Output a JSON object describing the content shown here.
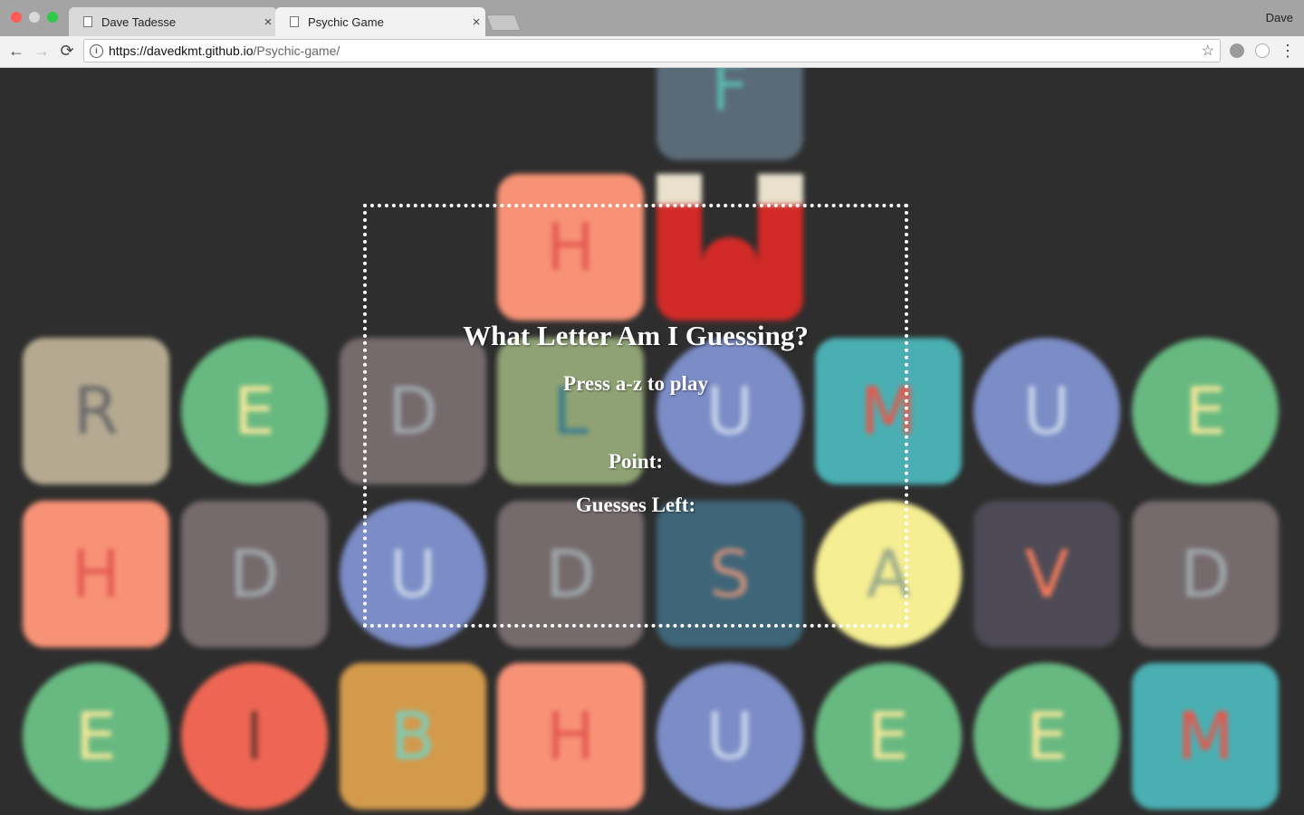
{
  "browser": {
    "tabs": [
      {
        "title": "Dave Tadesse",
        "active": false
      },
      {
        "title": "Psychic Game",
        "active": true
      }
    ],
    "profile_name": "Dave",
    "url_host": "https://davedkmt.github.io",
    "url_path": "/Psychic-game/",
    "close_glyph": "×",
    "back_glyph": "←",
    "forward_glyph": "→",
    "reload_glyph": "⟳",
    "star_glyph": "☆",
    "menu_glyph": "⋮"
  },
  "game": {
    "title": "What Letter Am I Guessing?",
    "instructions": "Press a-z to play",
    "point_label": "Point:",
    "guesses_left_label": "Guesses Left:"
  },
  "background_tiles": [
    {
      "letter": "F",
      "bg": "#5a6b78",
      "fg": "#5ab8b0",
      "shape": "sq"
    },
    {
      "letter": "H",
      "bg": "#f79276",
      "fg": "#e45a52",
      "shape": "sq"
    },
    {
      "letter": "L",
      "bg": "#d22a27",
      "fg": "#e9e1cc",
      "shape": "sq"
    },
    {
      "letter": "R",
      "bg": "#b5aa91",
      "fg": "#6b6b6b",
      "shape": "sq"
    },
    {
      "letter": "E",
      "bg": "#67b981",
      "fg": "#f5e79a",
      "shape": "ci"
    },
    {
      "letter": "D",
      "bg": "#756a6c",
      "fg": "#9fa8ab",
      "shape": "sq"
    },
    {
      "letter": "L",
      "bg": "#8fa274",
      "fg": "#3e7d8c",
      "shape": "sq"
    },
    {
      "letter": "U",
      "bg": "#7b8cc6",
      "fg": "#c6d4e8",
      "shape": "ci"
    },
    {
      "letter": "M",
      "bg": "#4aafb2",
      "fg": "#e8574b",
      "shape": "sq"
    },
    {
      "letter": "U",
      "bg": "#7b8cc6",
      "fg": "#c6d4e8",
      "shape": "ci"
    },
    {
      "letter": "E",
      "bg": "#67b981",
      "fg": "#f5e79a",
      "shape": "ci"
    },
    {
      "letter": "H",
      "bg": "#f79276",
      "fg": "#e45a52",
      "shape": "sq"
    },
    {
      "letter": "D",
      "bg": "#756a6c",
      "fg": "#9fa8ab",
      "shape": "sq"
    },
    {
      "letter": "U",
      "bg": "#7b8cc6",
      "fg": "#c6d4e8",
      "shape": "ci"
    },
    {
      "letter": "D",
      "bg": "#756a6c",
      "fg": "#9fa8ab",
      "shape": "sq"
    },
    {
      "letter": "S",
      "bg": "#3e6578",
      "fg": "#c58e7b",
      "shape": "sq"
    },
    {
      "letter": "A",
      "bg": "#f6ee92",
      "fg": "#98a98a",
      "shape": "ci"
    },
    {
      "letter": "V",
      "bg": "#4d4a55",
      "fg": "#ef7a5b",
      "shape": "sq"
    },
    {
      "letter": "D",
      "bg": "#756a6c",
      "fg": "#9fa8ab",
      "shape": "sq"
    },
    {
      "letter": "E",
      "bg": "#67b981",
      "fg": "#f5e79a",
      "shape": "ci"
    },
    {
      "letter": "I",
      "bg": "#ee6653",
      "fg": "#7a3a33",
      "shape": "ci"
    },
    {
      "letter": "B",
      "bg": "#d39a4c",
      "fg": "#7dcdb8",
      "shape": "sq"
    },
    {
      "letter": "H",
      "bg": "#f79276",
      "fg": "#e45a52",
      "shape": "sq"
    },
    {
      "letter": "U",
      "bg": "#7b8cc6",
      "fg": "#c6d4e8",
      "shape": "ci"
    },
    {
      "letter": "E",
      "bg": "#67b981",
      "fg": "#f5e79a",
      "shape": "ci"
    },
    {
      "letter": "E",
      "bg": "#67b981",
      "fg": "#f5e79a",
      "shape": "ci"
    },
    {
      "letter": "M",
      "bg": "#4aafb2",
      "fg": "#e8574b",
      "shape": "sq"
    }
  ]
}
